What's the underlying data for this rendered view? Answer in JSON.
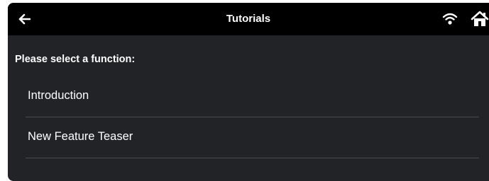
{
  "header": {
    "title": "Tutorials",
    "back_icon": "arrow-left-icon",
    "wifi_icon": "wifi-icon",
    "home_icon": "home-icon"
  },
  "main": {
    "prompt": "Please select a function:",
    "items": [
      {
        "label": "Introduction"
      },
      {
        "label": "New Feature Teaser"
      }
    ]
  },
  "colors": {
    "background": "#222327",
    "topbar": "#000000",
    "text": "#ffffff",
    "divider": "#4a4b50"
  }
}
